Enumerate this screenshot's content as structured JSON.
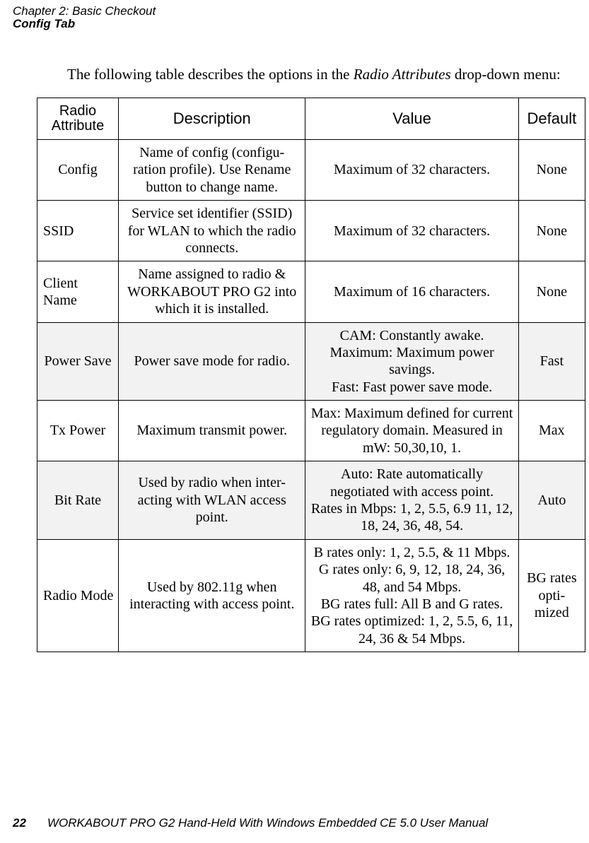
{
  "header": {
    "chapter_line": "Chapter  2:  Basic Checkout",
    "section_line": "Config Tab"
  },
  "intro": {
    "prefix": "The following table describes the options in the ",
    "emph": "Radio Attributes",
    "suffix": " drop-down menu:"
  },
  "table": {
    "headers": {
      "attr": "Radio Attribute",
      "desc": "Description",
      "value": "Value",
      "default": "Default"
    },
    "rows": [
      {
        "attr": "Config",
        "desc": "Name of config (configu-\nration profile). Use Rename button to change name.",
        "value": "Maximum of 32 characters.",
        "default": "None",
        "attr_align": "center"
      },
      {
        "attr": "SSID",
        "desc": "Service set identifier (SSID) for WLAN to which the radio connects.",
        "value": "Maximum of 32 characters.",
        "default": "None",
        "attr_align": "left"
      },
      {
        "attr": "Client Name",
        "desc": "Name assigned to radio & WORKABOUT PRO G2 into which it is installed.",
        "value": "Maximum of 16 characters.",
        "default": "None",
        "attr_align": "left"
      },
      {
        "attr": "Power Save",
        "desc": "Power save mode for radio.",
        "value": "CAM: Constantly awake.\nMaximum: Maximum power savings.\nFast: Fast power save mode.",
        "default": "Fast",
        "attr_align": "center",
        "shade": true
      },
      {
        "attr": "Tx Power",
        "desc": "Maximum transmit power.",
        "value": "Max: Maximum defined for current regulatory domain. Measured in mW: 50,30,10, 1.",
        "default": "Max",
        "attr_align": "center"
      },
      {
        "attr": "Bit Rate",
        "desc": "Used by radio when inter-\nacting with WLAN access point.",
        "value": "Auto: Rate automatically negotiated with access point.\nRates in Mbps: 1, 2, 5.5, 6.9 11, 12, 18, 24, 36, 48, 54.",
        "default": "Auto",
        "attr_align": "center",
        "shade": true
      },
      {
        "attr": "Radio Mode",
        "desc": "Used by 802.11g when interacting with access point.",
        "value": "B rates only: 1, 2, 5.5, & 11 Mbps.\nG rates only: 6, 9, 12, 18, 24, 36, 48, and 54 Mbps.\nBG rates full: All B and G rates.\nBG rates optimized: 1, 2, 5.5, 6, 11, 24, 36 & 54 Mbps.",
        "default": "BG rates opti-\nmized",
        "attr_align": "left"
      }
    ]
  },
  "footer": {
    "page_number": "22",
    "text": "WORKABOUT PRO G2 Hand-Held With Windows Embedded CE 5.0 User Manual"
  }
}
